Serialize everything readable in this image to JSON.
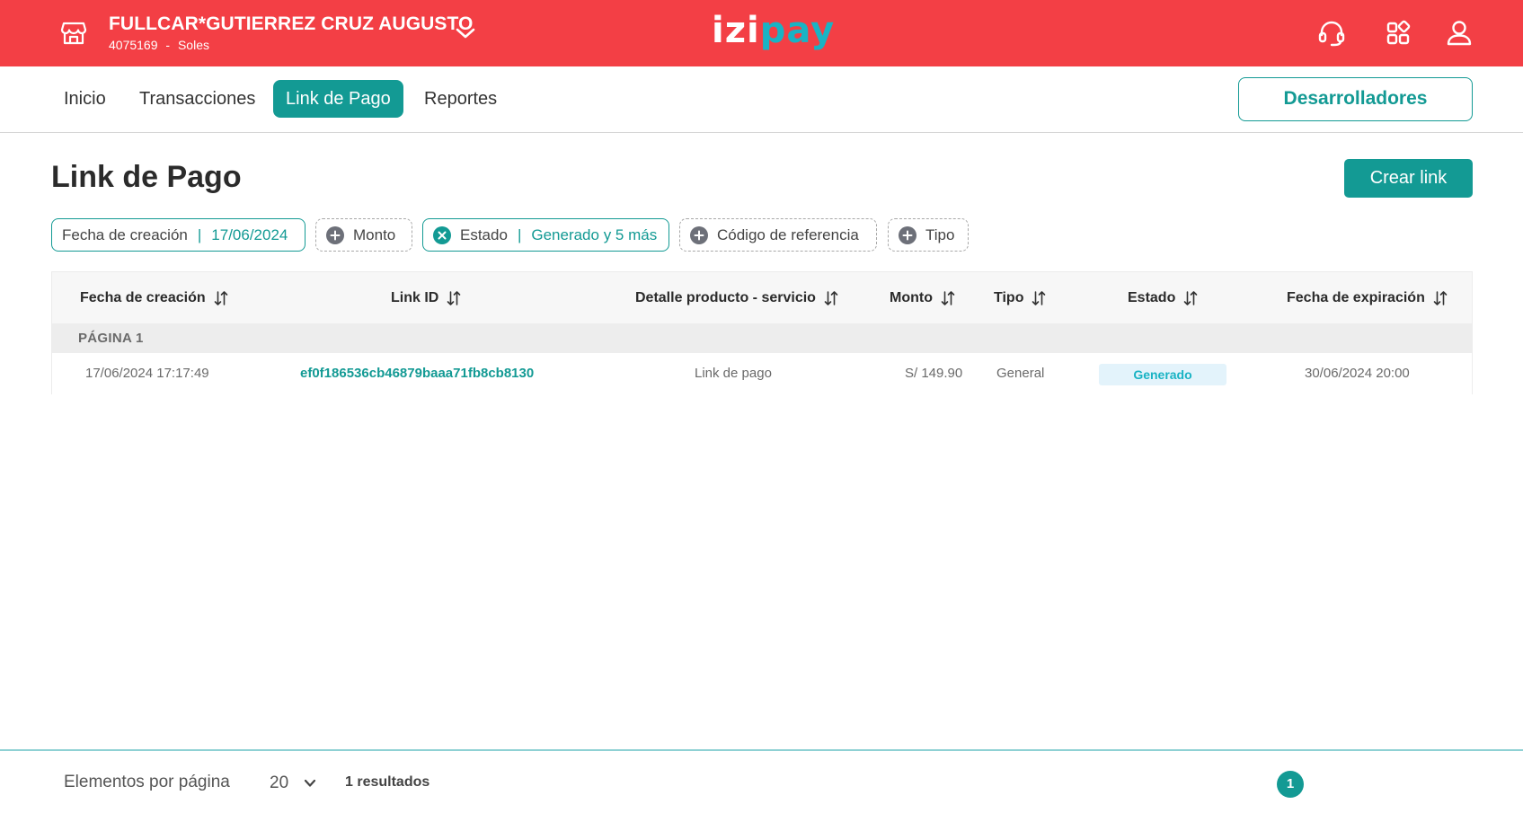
{
  "header": {
    "merchant_name": "FULLCAR*GUTIERREZ CRUZ AUGUSTO",
    "merchant_code": "4075169",
    "merchant_separator": "-",
    "currency": "Soles",
    "logo_izi": "izi",
    "logo_pay": "pay",
    "icons": [
      "store-icon",
      "chevron-down-icon",
      "headset-icon",
      "apps-grid-icon",
      "user-icon"
    ]
  },
  "nav": {
    "tabs": [
      {
        "label": "Inicio"
      },
      {
        "label": "Transacciones"
      },
      {
        "label": "Link de Pago",
        "active": true
      },
      {
        "label": "Reportes"
      }
    ],
    "developers_label": "Desarrolladores"
  },
  "main": {
    "title": "Link de Pago",
    "create_label": "Crear link"
  },
  "filters": {
    "fecha": {
      "label": "Fecha de creación",
      "value": "17/06/2024"
    },
    "monto": {
      "label": "Monto"
    },
    "estado": {
      "label": "Estado",
      "value": "Generado y 5 más"
    },
    "codigo": {
      "label": "Código de referencia"
    },
    "tipo": {
      "label": "Tipo"
    }
  },
  "table": {
    "columns": [
      "Fecha de creación",
      "Link ID",
      "Detalle producto - servicio",
      "Monto",
      "Tipo",
      "Estado",
      "Fecha de expiración"
    ],
    "group_label": "PÁGINA 1",
    "rows": [
      {
        "created": "17/06/2024 17:17:49",
        "link_id": "ef0f186536cb46879baaa71fb8cb8130",
        "detail": "Link de pago",
        "amount": "S/ 149.90",
        "type": "General",
        "status": "Generado",
        "expires": "30/06/2024 20:00"
      }
    ]
  },
  "footer": {
    "per_page_label": "Elementos por página",
    "per_page_value": "20",
    "results": "1 resultados",
    "current_page": "1"
  },
  "colors": {
    "header_red": "#f33f45",
    "teal": "#139a94",
    "logo_cyan": "#19b3c4",
    "badge_bg": "#e3f3fb"
  }
}
